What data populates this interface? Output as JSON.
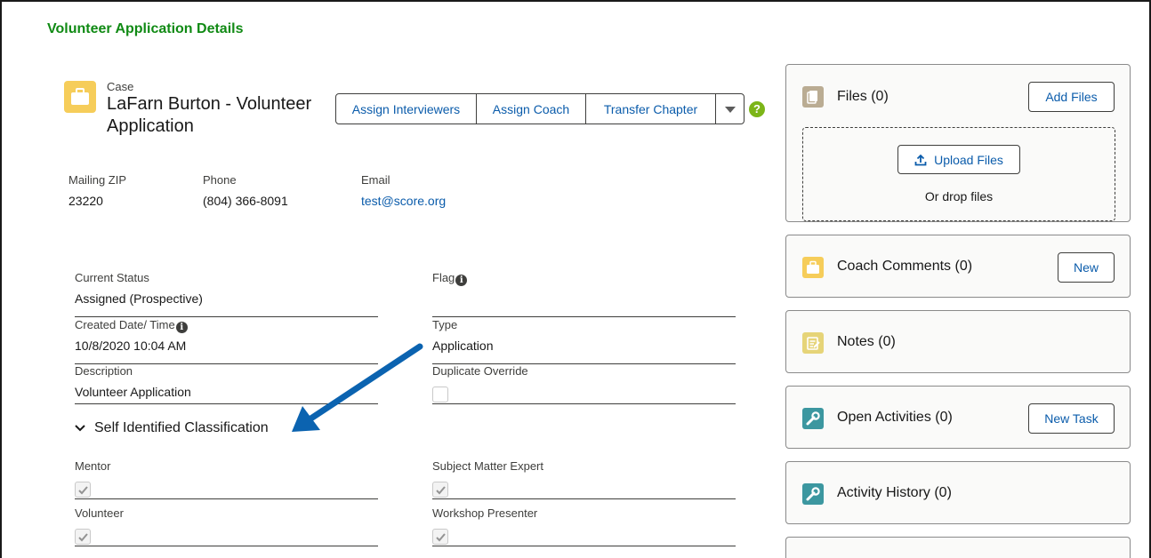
{
  "page": {
    "title": "Volunteer Application Details"
  },
  "record": {
    "object_label": "Case",
    "name": "LaFarn Burton - Volunteer Application",
    "icon": "briefcase-icon",
    "icon_color": "#f6cd5a"
  },
  "actions": {
    "assign_interviewers": "Assign Interviewers",
    "assign_coach": "Assign Coach",
    "transfer_chapter": "Transfer Chapter",
    "more": "▼",
    "help": "?"
  },
  "highlights": [
    {
      "label": "Mailing ZIP",
      "value": "23220"
    },
    {
      "label": "Phone",
      "value": "(804) 366-8091"
    },
    {
      "label": "Email",
      "value": "test@score.org"
    }
  ],
  "fields": {
    "current_status": {
      "label": "Current Status",
      "value": "Assigned (Prospective)"
    },
    "flag": {
      "label": "Flag",
      "value": ""
    },
    "created": {
      "label": "Created Date/ Time",
      "value": "10/8/2020 10:04 AM"
    },
    "type": {
      "label": "Type",
      "value": "Application"
    },
    "description": {
      "label": "Description",
      "value": "Volunteer Application"
    },
    "duplicate_override": {
      "label": "Duplicate Override",
      "checked": false
    }
  },
  "classification": {
    "title": "Self Identified Classification",
    "mentor": {
      "label": "Mentor",
      "checked": true
    },
    "sme": {
      "label": "Subject Matter Expert",
      "checked": true
    },
    "volunteer": {
      "label": "Volunteer",
      "checked": true
    },
    "workshop": {
      "label": "Workshop Presenter",
      "checked": true
    }
  },
  "related": {
    "files": {
      "title": "Files (0)",
      "button": "Add Files",
      "upload": "Upload Files",
      "drop": "Or drop files",
      "icon_color": "#baac93"
    },
    "coach_comments": {
      "title": "Coach Comments (0)",
      "button": "New",
      "icon_color": "#f6cd5a"
    },
    "notes": {
      "title": "Notes (0)",
      "icon_color": "#e6d478"
    },
    "open_activities": {
      "title": "Open Activities (0)",
      "button": "New Task",
      "icon_color": "#3c97a0"
    },
    "activity_history": {
      "title": "Activity History (0)",
      "icon_color": "#3c97a0"
    }
  },
  "colors": {
    "accent_title": "#108a14",
    "link": "#0b5cab",
    "annotation_arrow": "#0b63b0"
  }
}
